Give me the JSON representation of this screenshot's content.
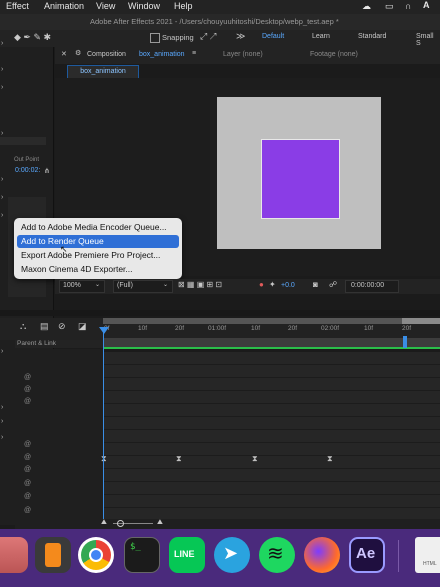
{
  "menubar": {
    "items": [
      "Effect",
      "Animation",
      "View",
      "Window",
      "Help"
    ],
    "clock_icons": [
      "creative-cloud-icon",
      "airplay-icon",
      "headphones-icon",
      "text-input-icon"
    ]
  },
  "titlebar": {
    "title": "Adobe After Effects 2021 - /Users/chouyuuhitoshi/Desktop/webp_test.aep *"
  },
  "toolbar": {
    "snapping": "Snapping",
    "workspaces": [
      "Default",
      "Learn",
      "Standard",
      "Small S"
    ]
  },
  "comp_panel": {
    "composition_label": "Composition",
    "composition_name": "box_animation",
    "layer_tab": "Layer (none)",
    "footage_tab": "Footage (none)",
    "comp_tab": "box_animation"
  },
  "left_panel": {
    "out_point_label": "Out Point",
    "out_point_value": "0:00:02:"
  },
  "context_menu": {
    "items": [
      "Add to Adobe Media Encoder Queue...",
      "Add to Render Queue",
      "Export Adobe Premiere Pro Project...",
      "Maxon Cinema 4D Exporter..."
    ],
    "selected_index": 1
  },
  "viewer_bar": {
    "zoom": "100%",
    "resolution": "(Full)",
    "exposure": "+0.0",
    "timecode": "0:00:00:00"
  },
  "timeline": {
    "parent_link_label": "Parent & Link",
    "ruler_labels": [
      "0f",
      "10f",
      "20f",
      "01:00f",
      "10f",
      "20f",
      "02:00f",
      "10f",
      "20f"
    ]
  },
  "dock": {
    "apps": [
      "finder",
      "sublime-text",
      "chrome",
      "terminal",
      "line",
      "telegram",
      "spotify",
      "firefox",
      "after-effects",
      "document"
    ],
    "ae_label": "Ae",
    "line_label": "LINE",
    "doc_label": "HTML"
  },
  "colors": {
    "selection_blue": "#2f6fd6",
    "comp_background": "#bfbfbf",
    "square_fill": "#8a3de6",
    "dock_background": "#4a2a7c",
    "timeline_accent": "#3a8ee6"
  }
}
